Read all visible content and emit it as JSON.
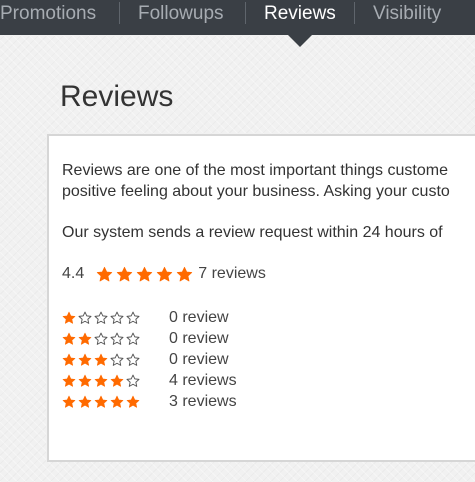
{
  "nav": {
    "tabs": [
      {
        "label": "Promotions",
        "active": false
      },
      {
        "label": "Followups",
        "active": false
      },
      {
        "label": "Reviews",
        "active": true
      },
      {
        "label": "Visibility",
        "active": false
      }
    ]
  },
  "page": {
    "title": "Reviews"
  },
  "intro": {
    "line1": "Reviews are one of the most important things custome",
    "line2": "positive feeling about your business. Asking your custo",
    "line3": "Our system sends a review request within 24 hours of"
  },
  "summary": {
    "average": "4.4",
    "average_stars": 5,
    "count_label": "7 reviews"
  },
  "distribution": [
    {
      "stars": 1,
      "label": "0 review"
    },
    {
      "stars": 2,
      "label": "0 review"
    },
    {
      "stars": 3,
      "label": "0 review"
    },
    {
      "stars": 4,
      "label": "4 reviews"
    },
    {
      "stars": 5,
      "label": "3 reviews"
    }
  ],
  "colors": {
    "nav_bg": "#3a3f45",
    "star_fill": "#ff6a00",
    "star_empty_stroke": "#555555"
  },
  "icons": {
    "filled_star": "star-filled-icon",
    "empty_star": "star-outline-icon"
  }
}
